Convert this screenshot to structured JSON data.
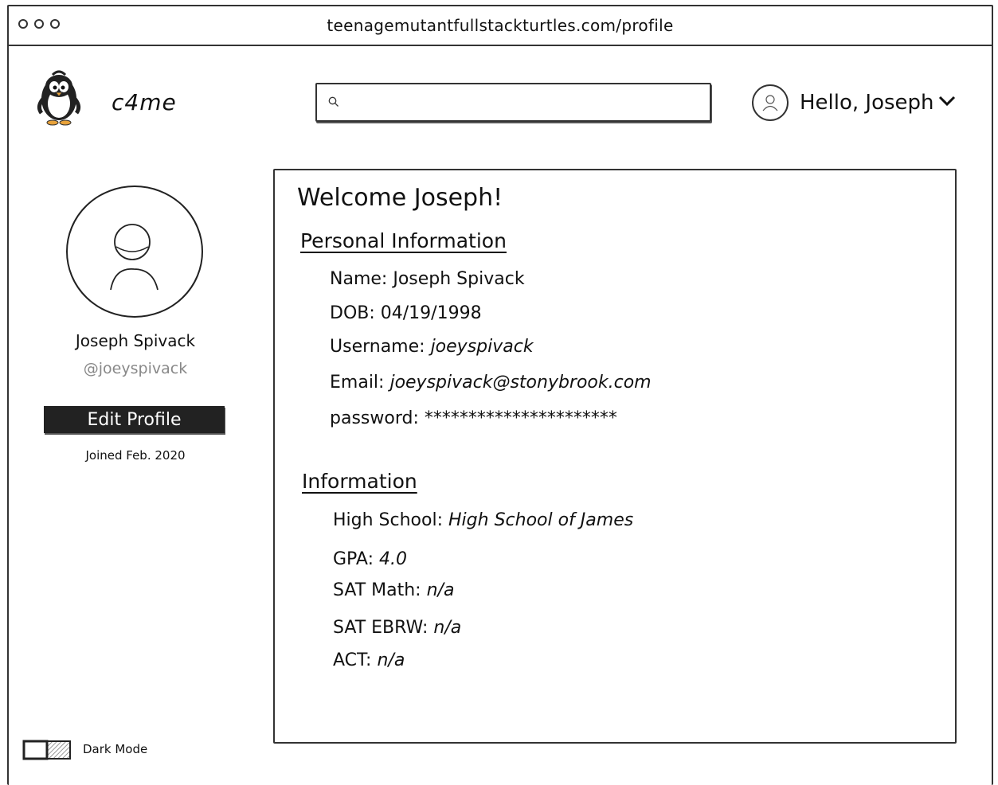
{
  "browser": {
    "url": "teenagemutantfullstackturtles.com/profile"
  },
  "header": {
    "brand": "c4me",
    "search_placeholder": "",
    "greeting": "Hello, Joseph"
  },
  "sidebar": {
    "name": "Joseph Spivack",
    "handle": "@joeyspivack",
    "edit_button": "Edit Profile",
    "joined": "Joined Feb. 2020"
  },
  "main": {
    "welcome": "Welcome Joseph!",
    "personal": {
      "heading": "Personal Information",
      "rows": [
        {
          "label": "Name:",
          "value": "Joseph Spivack"
        },
        {
          "label": "DOB:",
          "value": "04/19/1998"
        },
        {
          "label": "Username:",
          "value": "joeyspivack"
        },
        {
          "label": "Email:",
          "value": "joeyspivack@stonybrook.com"
        },
        {
          "label": "password:",
          "value": "**********************"
        }
      ]
    },
    "info": {
      "heading": "Information",
      "rows": [
        {
          "label": "High School:",
          "value": "High School of James"
        },
        {
          "label": "GPA:",
          "value": "4.0"
        },
        {
          "label": "SAT Math:",
          "value": "n/a"
        },
        {
          "label": "SAT EBRW:",
          "value": "n/a"
        },
        {
          "label": "ACT:",
          "value": "n/a"
        }
      ]
    }
  },
  "footer": {
    "dark_mode_label": "Dark Mode",
    "dark_mode_on": false
  },
  "icons": {
    "logo": "penguin-icon",
    "search": "search-icon",
    "avatar": "user-icon",
    "dropdown": "chevron-down-icon"
  }
}
